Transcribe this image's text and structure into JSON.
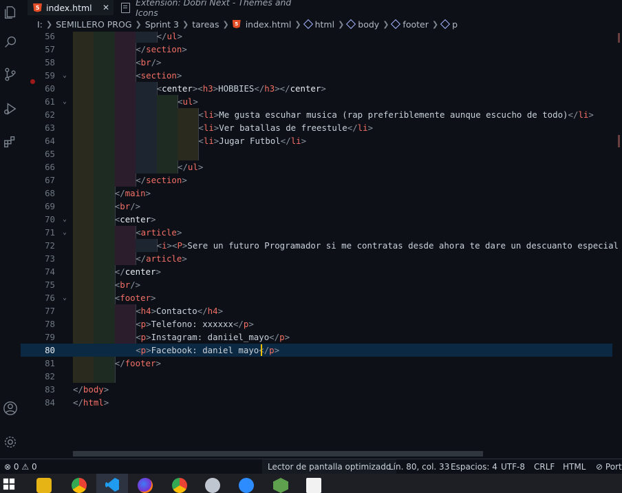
{
  "tabs": {
    "active_badge": "5",
    "active_label": "index.html",
    "close_glyph": "✕",
    "extension_label": "Extensión: Dobri Next - Themes and Icons"
  },
  "breadcrumb": {
    "items": [
      "I:",
      "SEMILLERO PROG",
      "Sprint 3",
      "tareas",
      "index.html",
      "html",
      "body",
      "footer",
      "p"
    ],
    "badge": "5"
  },
  "editor": {
    "active_line": "80",
    "lines": [
      {
        "n": "56",
        "fold": "",
        "indent": 4,
        "tokens": [
          [
            "p",
            "</"
          ],
          [
            "t",
            "ul"
          ],
          [
            "p",
            ">"
          ]
        ]
      },
      {
        "n": "57",
        "fold": "",
        "indent": 3,
        "tokens": [
          [
            "p",
            "</"
          ],
          [
            "t",
            "section"
          ],
          [
            "p",
            ">"
          ]
        ]
      },
      {
        "n": "58",
        "fold": "",
        "indent": 3,
        "tokens": [
          [
            "p",
            "<"
          ],
          [
            "t",
            "br"
          ],
          [
            "p",
            "/>"
          ]
        ]
      },
      {
        "n": "59",
        "fold": "v",
        "indent": 3,
        "tokens": [
          [
            "p",
            "<"
          ],
          [
            "t",
            "section"
          ],
          [
            "p",
            ">"
          ]
        ]
      },
      {
        "n": "60",
        "fold": "",
        "indent": 4,
        "tokens": [
          [
            "p",
            "<"
          ],
          [
            "b",
            "center"
          ],
          [
            "p",
            "><"
          ],
          [
            "t",
            "h3"
          ],
          [
            "p",
            ">"
          ],
          [
            "x",
            "HOBBIES"
          ],
          [
            "p",
            "</"
          ],
          [
            "t",
            "h3"
          ],
          [
            "p",
            "></"
          ],
          [
            "b",
            "center"
          ],
          [
            "p",
            ">"
          ]
        ]
      },
      {
        "n": "61",
        "fold": "v",
        "indent": 5,
        "tokens": [
          [
            "p",
            "<"
          ],
          [
            "t",
            "ul"
          ],
          [
            "p",
            ">"
          ]
        ]
      },
      {
        "n": "62",
        "fold": "",
        "indent": 6,
        "tokens": [
          [
            "p",
            "<"
          ],
          [
            "t",
            "li"
          ],
          [
            "p",
            ">"
          ],
          [
            "x",
            "Me gusta escuhar musica (rap preferiblemente aunque escucho de todo)"
          ],
          [
            "p",
            "</"
          ],
          [
            "t",
            "li"
          ],
          [
            "p",
            ">"
          ]
        ]
      },
      {
        "n": "63",
        "fold": "",
        "indent": 6,
        "tokens": [
          [
            "p",
            "<"
          ],
          [
            "t",
            "li"
          ],
          [
            "p",
            ">"
          ],
          [
            "x",
            "Ver batallas de freestule"
          ],
          [
            "p",
            "</"
          ],
          [
            "t",
            "li"
          ],
          [
            "p",
            ">"
          ]
        ]
      },
      {
        "n": "64",
        "fold": "",
        "indent": 6,
        "tokens": [
          [
            "p",
            "<"
          ],
          [
            "t",
            "li"
          ],
          [
            "p",
            ">"
          ],
          [
            "x",
            "Jugar Futbol"
          ],
          [
            "p",
            "</"
          ],
          [
            "t",
            "li"
          ],
          [
            "p",
            ">"
          ]
        ]
      },
      {
        "n": "65",
        "fold": "",
        "indent": 0,
        "tokens": []
      },
      {
        "n": "66",
        "fold": "",
        "indent": 5,
        "tokens": [
          [
            "p",
            "</"
          ],
          [
            "t",
            "ul"
          ],
          [
            "p",
            ">"
          ]
        ]
      },
      {
        "n": "67",
        "fold": "",
        "indent": 3,
        "tokens": [
          [
            "p",
            "</"
          ],
          [
            "t",
            "section"
          ],
          [
            "p",
            ">"
          ]
        ]
      },
      {
        "n": "68",
        "fold": "",
        "indent": 2,
        "tokens": [
          [
            "p",
            "</"
          ],
          [
            "t",
            "main"
          ],
          [
            "p",
            ">"
          ]
        ]
      },
      {
        "n": "69",
        "fold": "",
        "indent": 2,
        "tokens": [
          [
            "p",
            "<"
          ],
          [
            "t",
            "br"
          ],
          [
            "p",
            "/>"
          ]
        ]
      },
      {
        "n": "70",
        "fold": "v",
        "indent": 2,
        "tokens": [
          [
            "p",
            "<"
          ],
          [
            "b",
            "center"
          ],
          [
            "p",
            ">"
          ]
        ]
      },
      {
        "n": "71",
        "fold": "v",
        "indent": 3,
        "tokens": [
          [
            "p",
            "<"
          ],
          [
            "t",
            "article"
          ],
          [
            "p",
            ">"
          ]
        ]
      },
      {
        "n": "72",
        "fold": "",
        "indent": 4,
        "tokens": [
          [
            "p",
            "<"
          ],
          [
            "t",
            "i"
          ],
          [
            "p",
            "><"
          ],
          [
            "t",
            "P"
          ],
          [
            "p",
            ">"
          ],
          [
            "x",
            "Sere un futuro Programador si me contratas desde ahora te dare un descuanto especial"
          ]
        ]
      },
      {
        "n": "73",
        "fold": "",
        "indent": 3,
        "tokens": [
          [
            "p",
            "</"
          ],
          [
            "t",
            "article"
          ],
          [
            "p",
            ">"
          ]
        ]
      },
      {
        "n": "74",
        "fold": "",
        "indent": 2,
        "tokens": [
          [
            "p",
            "</"
          ],
          [
            "b",
            "center"
          ],
          [
            "p",
            ">"
          ]
        ]
      },
      {
        "n": "75",
        "fold": "",
        "indent": 2,
        "tokens": [
          [
            "p",
            "<"
          ],
          [
            "t",
            "br"
          ],
          [
            "p",
            "/>"
          ]
        ]
      },
      {
        "n": "76",
        "fold": "v",
        "indent": 2,
        "tokens": [
          [
            "p",
            "<"
          ],
          [
            "t",
            "footer"
          ],
          [
            "p",
            ">"
          ]
        ]
      },
      {
        "n": "77",
        "fold": "",
        "indent": 3,
        "tokens": [
          [
            "p",
            "<"
          ],
          [
            "t",
            "h4"
          ],
          [
            "p",
            ">"
          ],
          [
            "x",
            "Contacto"
          ],
          [
            "p",
            "</"
          ],
          [
            "t",
            "h4"
          ],
          [
            "p",
            ">"
          ]
        ]
      },
      {
        "n": "78",
        "fold": "",
        "indent": 3,
        "tokens": [
          [
            "p",
            "<"
          ],
          [
            "t",
            "p"
          ],
          [
            "p",
            ">"
          ],
          [
            "x",
            "Telefono: xxxxxx"
          ],
          [
            "p",
            "</"
          ],
          [
            "t",
            "p"
          ],
          [
            "p",
            ">"
          ]
        ]
      },
      {
        "n": "79",
        "fold": "",
        "indent": 3,
        "tokens": [
          [
            "p",
            "<"
          ],
          [
            "t",
            "p"
          ],
          [
            "p",
            ">"
          ],
          [
            "x",
            "Instagram: daniiel_mayo"
          ],
          [
            "p",
            "</"
          ],
          [
            "t",
            "p"
          ],
          [
            "p",
            ">"
          ]
        ]
      },
      {
        "n": "80",
        "fold": "",
        "indent": 3,
        "tokens": [
          [
            "p",
            "<"
          ],
          [
            "t",
            "p"
          ],
          [
            "p",
            ">"
          ],
          [
            "x",
            "Facebook: daniel mayo"
          ],
          [
            "p",
            "</"
          ],
          [
            "t",
            "p"
          ],
          [
            "p",
            ">"
          ]
        ]
      },
      {
        "n": "81",
        "fold": "",
        "indent": 2,
        "tokens": [
          [
            "p",
            "</"
          ],
          [
            "t",
            "footer"
          ],
          [
            "p",
            ">"
          ]
        ]
      },
      {
        "n": "82",
        "fold": "",
        "indent": 0,
        "tokens": []
      },
      {
        "n": "83",
        "fold": "",
        "indent": 0,
        "tokens": [
          [
            "p",
            "</"
          ],
          [
            "t",
            "body"
          ],
          [
            "p",
            ">"
          ]
        ]
      },
      {
        "n": "84",
        "fold": "",
        "indent": 0,
        "tokens": [
          [
            "p",
            "</"
          ],
          [
            "t",
            "html"
          ],
          [
            "p",
            ">"
          ]
        ]
      }
    ]
  },
  "status": {
    "errors": "0",
    "warnings": "0",
    "screen_reader": "Lector de pantalla optimizado",
    "position": "Lín. 80, col. 33",
    "spaces": "Espacios: 4",
    "encoding": "UTF-8",
    "eol": "CRLF",
    "language": "HTML",
    "port": "Port"
  },
  "icons": {
    "activity": [
      "explorer-icon",
      "search-icon",
      "source-control-icon",
      "run-debug-icon",
      "extensions-icon",
      "account-icon",
      "settings-gear-icon"
    ],
    "taskbar": [
      "windows-start-icon",
      "file-explorer-icon",
      "chrome-icon",
      "vscode-icon",
      "firefox-icon",
      "chrome-icon",
      "paint-icon",
      "zoom-icon",
      "nodejs-icon",
      "dinosaur-icon"
    ]
  },
  "colors": {
    "tag": "#f47067",
    "punct": "#8b949e",
    "text": "#c9d1d9",
    "active_line_bg": "#0b2942",
    "cursor": "#f0c000",
    "html5": "#e44d26"
  }
}
